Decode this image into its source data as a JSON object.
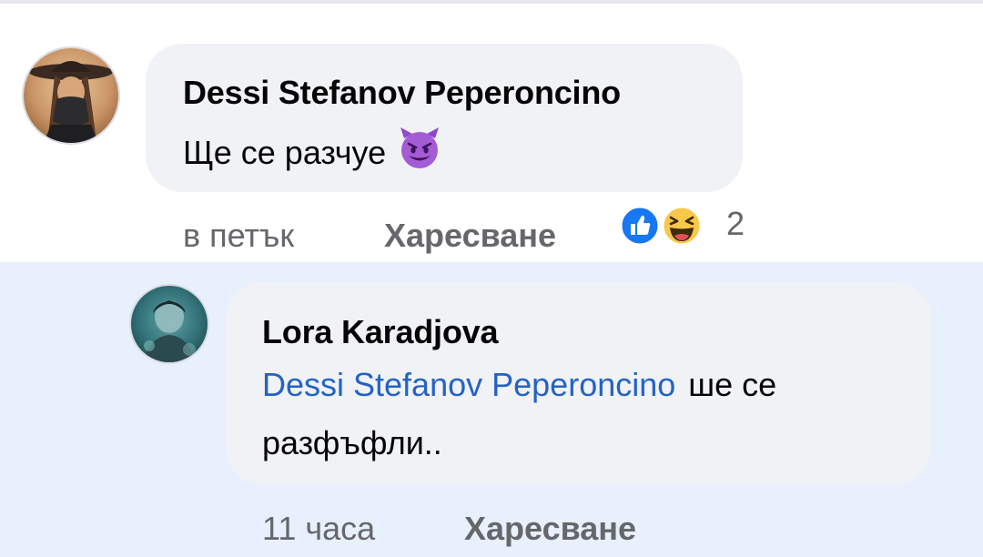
{
  "comment": {
    "author": "Dessi Stefanov Peperoncino",
    "text": "Ще се разчуе",
    "emoji": "smiling-devil-emoji",
    "time": "в петък",
    "like_label": "Харесване",
    "reactions": [
      "like",
      "haha"
    ],
    "reaction_count": "2"
  },
  "reply": {
    "author": "Lora Karadjova",
    "mention": "Dessi Stefanov Peperoncino",
    "text_line1": "ше се",
    "text_line2": "разфъфли..",
    "time": "11 часа",
    "like_label": "Харесване"
  },
  "colors": {
    "reply_background": "#e8f0fd",
    "bubble": "#f0f2f5",
    "mention": "#2463c5",
    "like_blue": "#1877f2",
    "haha_yellow": "#f7c84a",
    "devil_purple": "#a45bd6"
  }
}
